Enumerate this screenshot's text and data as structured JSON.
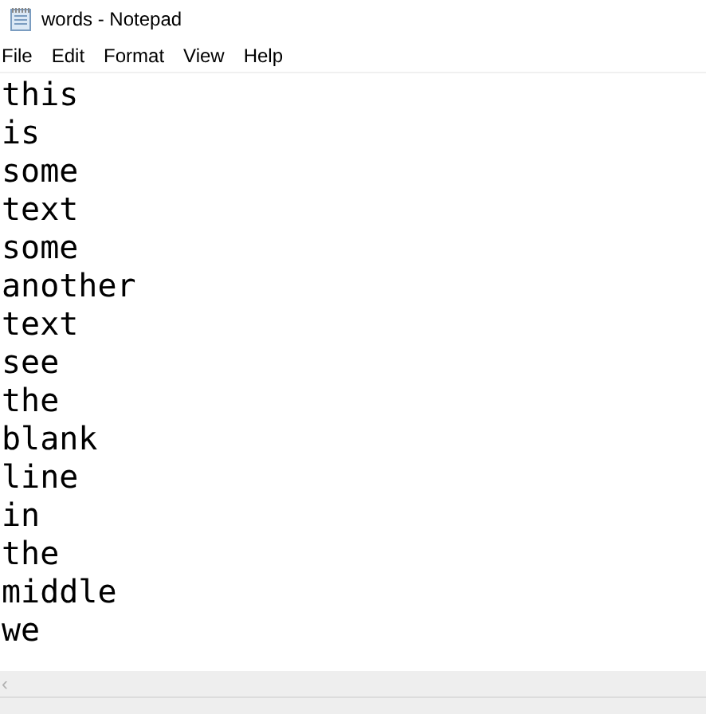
{
  "window": {
    "title": "words - Notepad"
  },
  "menu": [
    "File",
    "Edit",
    "Format",
    "View",
    "Help"
  ],
  "lines": [
    "this",
    "is",
    "some",
    "text",
    "some",
    "another",
    "text",
    "see",
    "the",
    "blank",
    "line",
    "in",
    "the",
    "middle",
    "we"
  ],
  "horizontal_scrollbar": {
    "left_arrow": "‹"
  }
}
